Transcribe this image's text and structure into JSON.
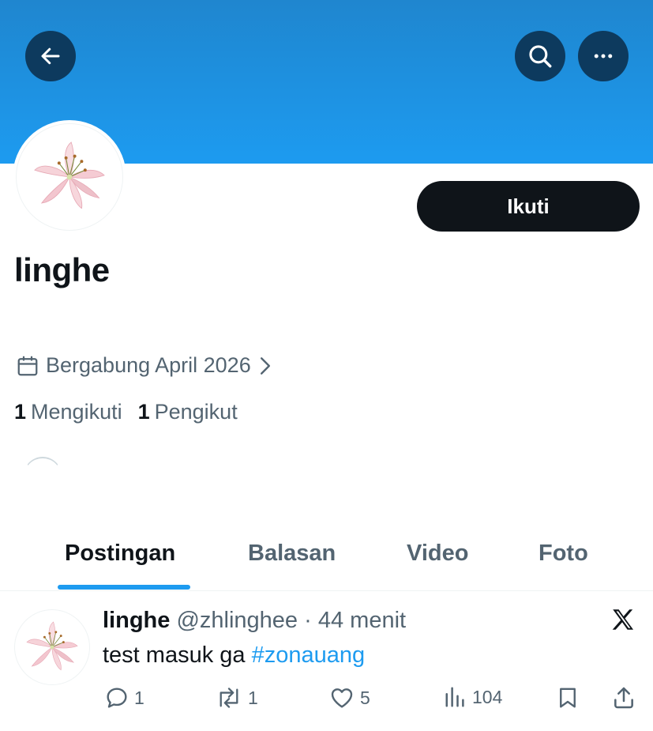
{
  "header": {
    "back_icon": "arrow-left-icon",
    "search_icon": "search-icon",
    "more_icon": "more-horizontal-icon"
  },
  "colors": {
    "banner_top": "#1f86cf",
    "banner_bottom": "#1d9bf0",
    "accent": "#1d9bf0",
    "text_primary": "#0f1419",
    "text_secondary": "#536471"
  },
  "profile": {
    "display_name": "linghe",
    "follow_label": "Ikuti",
    "joined": "Bergabung April 2026",
    "following_count": "1",
    "following_label": "Mengikuti",
    "followers_count": "1",
    "followers_label": "Pengikut",
    "avatar_icon": "lily-flower-avatar"
  },
  "tabs": [
    {
      "label": "Postingan",
      "active": true
    },
    {
      "label": "Balasan",
      "active": false
    },
    {
      "label": "Video",
      "active": false
    },
    {
      "label": "Foto",
      "active": false
    }
  ],
  "post": {
    "name": "linghe",
    "handle": "@zhlinghee",
    "separator": "·",
    "time": "44 menit",
    "text": "test masuk ga",
    "hashtag": "#zonauang",
    "source_icon": "x-logo-icon",
    "reply_count": "1",
    "repost_count": "1",
    "like_count": "5",
    "view_count": "104"
  }
}
